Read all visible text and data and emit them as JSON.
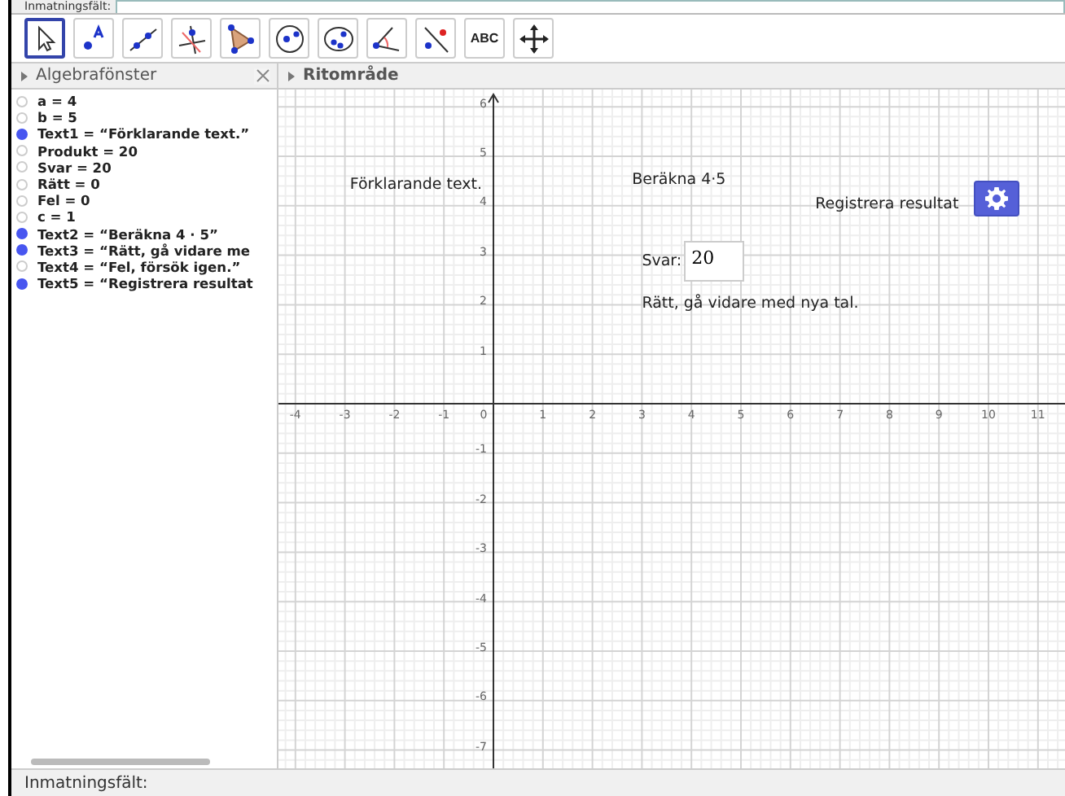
{
  "input_bar_top": {
    "label": "Inmatningsfält:"
  },
  "toolbar": [
    {
      "kind": "move",
      "selected": true
    },
    {
      "kind": "point",
      "selected": false
    },
    {
      "kind": "line",
      "selected": false
    },
    {
      "kind": "perpendicular",
      "selected": false
    },
    {
      "kind": "polygon",
      "selected": false
    },
    {
      "kind": "circle",
      "selected": false
    },
    {
      "kind": "conic",
      "selected": false
    },
    {
      "kind": "angle",
      "selected": false
    },
    {
      "kind": "reflect",
      "selected": false
    },
    {
      "kind": "text",
      "label": "ABC",
      "selected": false
    },
    {
      "kind": "pan",
      "selected": false
    }
  ],
  "algebra": {
    "title": "Algebrafönster",
    "items": [
      {
        "text": "a = 4",
        "visible": false
      },
      {
        "text": "b = 5",
        "visible": false
      },
      {
        "text": "Text1 = “Förklarande text.”",
        "visible": true
      },
      {
        "text": "Produkt = 20",
        "visible": false
      },
      {
        "text": "Svar = 20",
        "visible": false
      },
      {
        "text": "Rätt = 0",
        "visible": false
      },
      {
        "text": "Fel = 0",
        "visible": false
      },
      {
        "text": "c = 1",
        "visible": false
      },
      {
        "text": "Text2 = “Beräkna 4 · 5”",
        "visible": true
      },
      {
        "text": "Text3 = “Rätt, gå vidare me",
        "visible": true
      },
      {
        "text": "Text4 = “Fel, försök igen.”",
        "visible": false
      },
      {
        "text": "Text5 = “Registrera resultat",
        "visible": true
      }
    ]
  },
  "graphics": {
    "title": "Ritområde",
    "x_labels": [
      "-4",
      "-3",
      "-2",
      "-1",
      "0",
      "1",
      "2",
      "3",
      "4",
      "5",
      "6",
      "7",
      "8",
      "9",
      "10",
      "11"
    ],
    "y_labels": [
      "6",
      "5",
      "4",
      "3",
      "2",
      "1",
      "-1",
      "-2",
      "-3",
      "-4",
      "-5",
      "-6",
      "-7"
    ],
    "texts": [
      {
        "kind": "label",
        "text": "Förklarande text."
      },
      {
        "kind": "label",
        "text": "Beräkna 4·5"
      },
      {
        "kind": "label",
        "text": "Registrera resultat"
      },
      {
        "kind": "button"
      },
      {
        "kind": "input",
        "label": "Svar:",
        "value": "20"
      },
      {
        "kind": "label",
        "text": "Rätt, gå vidare med nya tal."
      }
    ]
  },
  "input_bar": {
    "label": "Inmatningsfält:"
  }
}
